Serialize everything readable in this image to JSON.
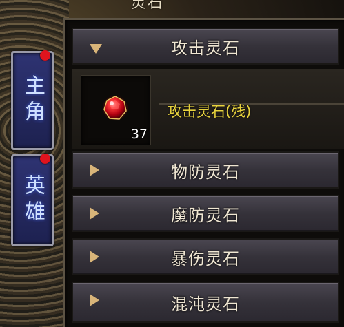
{
  "window": {
    "title": "灵石"
  },
  "side_tabs": [
    {
      "label": "主角",
      "has_notification": true
    },
    {
      "label": "英雄",
      "has_notification": true
    }
  ],
  "categories": [
    {
      "label": "攻击灵石",
      "expanded": true
    },
    {
      "label": "物防灵石",
      "expanded": false
    },
    {
      "label": "魔防灵石",
      "expanded": false
    },
    {
      "label": "暴伤灵石",
      "expanded": false
    },
    {
      "label": "混沌灵石",
      "expanded": false
    }
  ],
  "expanded_item": {
    "name": "攻击灵石(残)",
    "count": "37",
    "icon": "red-gem-icon"
  },
  "colors": {
    "item_name": "#e8d33e",
    "notification": "#e0141e",
    "tab_bg": "#2e3372",
    "arrow": "#d9b579"
  }
}
